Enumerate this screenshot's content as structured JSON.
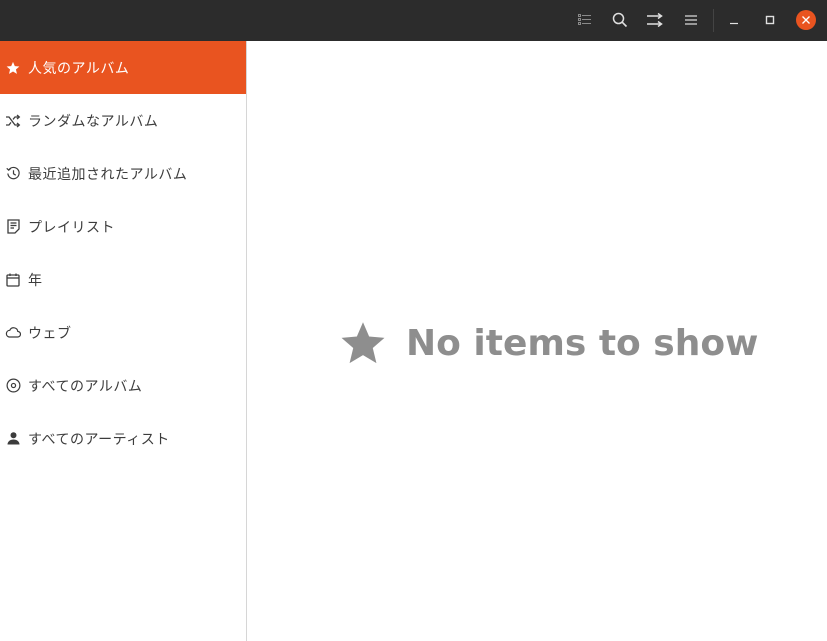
{
  "colors": {
    "accent": "#e95420",
    "titlebar": "#2c2c2c",
    "empty_text": "#8e8e8e"
  },
  "titlebar": {
    "buttons": [
      "list-view-icon",
      "search-icon",
      "shuffle-icon",
      "hamburger-menu-icon",
      "minimize-icon",
      "maximize-icon",
      "close-icon"
    ]
  },
  "sidebar": {
    "items": [
      {
        "label": "人気のアルバム",
        "icon": "star-icon",
        "active": true
      },
      {
        "label": "ランダムなアルバム",
        "icon": "shuffle-icon",
        "active": false
      },
      {
        "label": "最近追加されたアルバム",
        "icon": "history-icon",
        "active": false
      },
      {
        "label": "プレイリスト",
        "icon": "playlist-icon",
        "active": false
      },
      {
        "label": "年",
        "icon": "calendar-icon",
        "active": false
      },
      {
        "label": "ウェブ",
        "icon": "cloud-icon",
        "active": false
      },
      {
        "label": "すべてのアルバム",
        "icon": "disc-icon",
        "active": false
      },
      {
        "label": "すべてのアーティスト",
        "icon": "person-icon",
        "active": false
      }
    ]
  },
  "main": {
    "empty_message": "No items to show",
    "empty_icon": "star-icon"
  }
}
